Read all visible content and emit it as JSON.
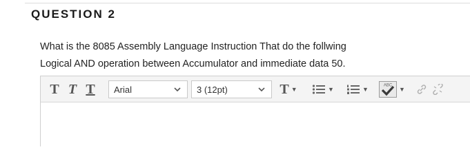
{
  "question": {
    "title": "QUESTION 2",
    "text_line1": "What is the 8085 Assembly Language Instruction That do the follwing",
    "text_line2": "Logical AND operation between Accumulator and immediate data 50."
  },
  "toolbar": {
    "bold_label": "T",
    "italic_label": "T",
    "underline_label": "T",
    "font_family": "Arial",
    "font_size": "3 (12pt)",
    "text_color_label": "T",
    "spellcheck_label": "ABC"
  },
  "colors": {
    "accent": "#555555",
    "spellcheck_check": "#3a3a3a",
    "link_icon": "#b0b0b0"
  }
}
